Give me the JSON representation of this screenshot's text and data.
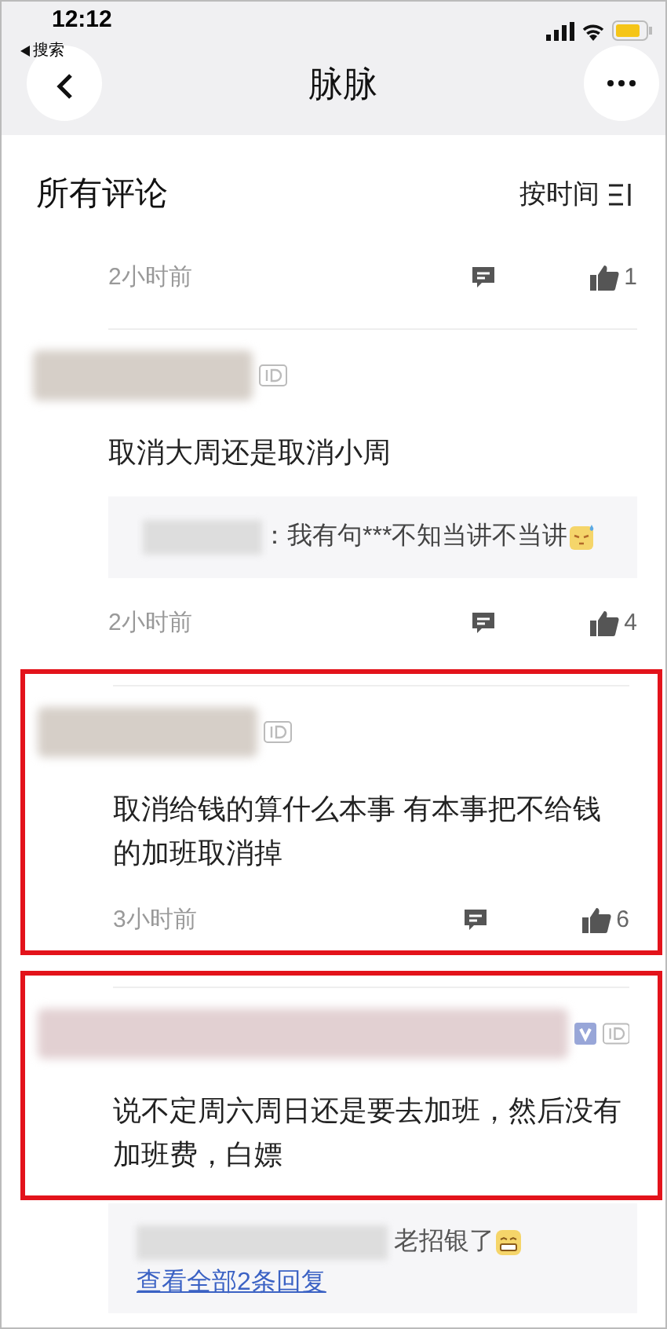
{
  "status_bar": {
    "time": "12:12",
    "back_label": "搜索"
  },
  "nav": {
    "title": "脉脉"
  },
  "section": {
    "title": "所有评论",
    "sort": "按时间"
  },
  "comments": [
    {
      "kind": "cut_off",
      "time": "2小时前",
      "likes": "1"
    },
    {
      "kind": "full",
      "highlighted": false,
      "verified": false,
      "text": "取消大周还是取消小周",
      "quote": "：我有句***不知当讲不当讲",
      "time": "2小时前",
      "likes": "4"
    },
    {
      "kind": "full",
      "highlighted": true,
      "verified": false,
      "text": "取消给钱的算什么本事 有本事把不给钱的加班取消掉",
      "time": "3小时前",
      "likes": "6"
    },
    {
      "kind": "full",
      "highlighted": true,
      "verified": true,
      "text": "说不定周六周日还是要去加班，然后没有加班费，白嫖",
      "reply": "老招银了",
      "reply_link": "查看全部2条回复"
    }
  ]
}
